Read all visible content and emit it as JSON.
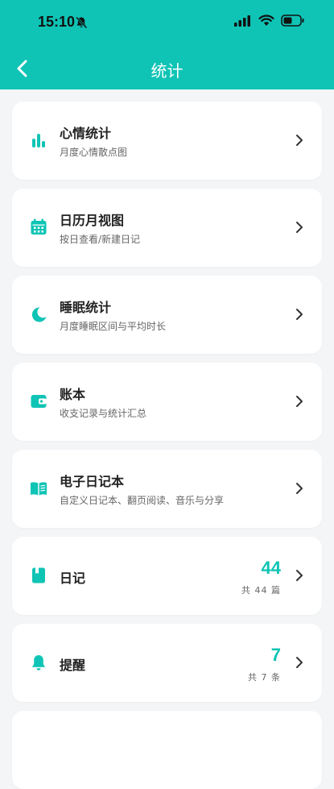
{
  "status": {
    "time": "15:10"
  },
  "header": {
    "title": "统计"
  },
  "cards": [
    {
      "title": "心情统计",
      "subtitle": "月度心情散点图",
      "icon": "bar-chart-icon"
    },
    {
      "title": "日历月视图",
      "subtitle": "按日查看/新建日记",
      "icon": "calendar-icon"
    },
    {
      "title": "睡眠统计",
      "subtitle": "月度睡眠区间与平均时长",
      "icon": "moon-icon"
    },
    {
      "title": "账本",
      "subtitle": "收支记录与统计汇总",
      "icon": "wallet-icon"
    },
    {
      "title": "电子日记本",
      "subtitle": "自定义日记本、翻页阅读、音乐与分享",
      "icon": "book-open-icon"
    },
    {
      "title": "日记",
      "count": "44",
      "count_label": "共 44 篇",
      "icon": "diary-icon"
    },
    {
      "title": "提醒",
      "count": "7",
      "count_label": "共 7 条",
      "icon": "bell-icon"
    }
  ],
  "colors": {
    "accent": "#0fc4b5",
    "background": "#f3f5f7"
  }
}
